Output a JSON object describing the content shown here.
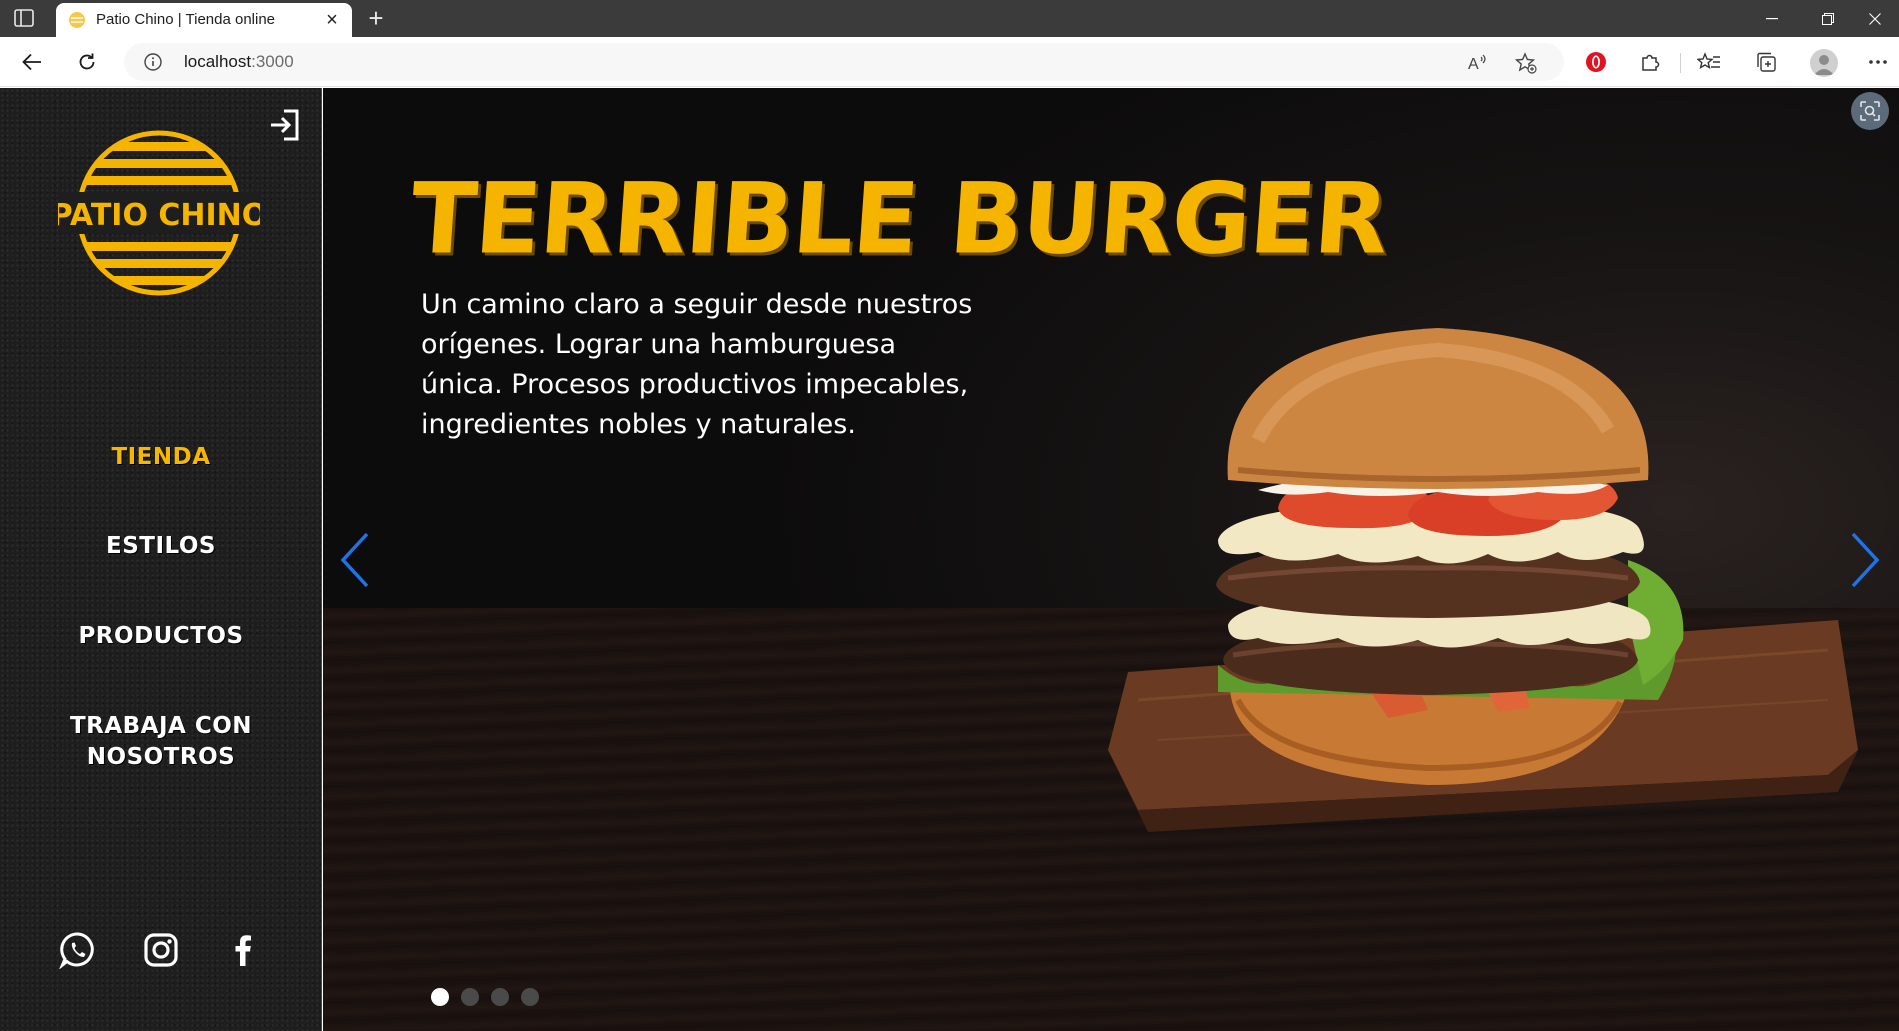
{
  "browser": {
    "tab_title": "Patio Chino | Tienda online",
    "tab_close": "×",
    "new_tab": "+",
    "url_host": "localhost",
    "url_port": ":3000"
  },
  "sidebar": {
    "logo_text": "PATIO CHINO",
    "nav": [
      {
        "label": "TIENDA",
        "active": true
      },
      {
        "label": "ESTILOS",
        "active": false
      },
      {
        "label": "PRODUCTOS",
        "active": false
      },
      {
        "label": "TRABAJA CON",
        "label2": "NOSOTROS",
        "active": false
      }
    ],
    "social": [
      "whatsapp-icon",
      "instagram-icon",
      "facebook-icon"
    ]
  },
  "hero": {
    "title": "TERRIBLE BURGER",
    "text": "Un camino claro a seguir desde nuestros orígenes. Lograr una hamburguesa única. Procesos productivos impecables, ingredientes nobles y naturales.",
    "slide_count": 4,
    "active_slide": 1
  },
  "colors": {
    "accent": "#f5b400",
    "sidebar_bg": "#1e1e1e",
    "arrow": "#1e73e8"
  }
}
